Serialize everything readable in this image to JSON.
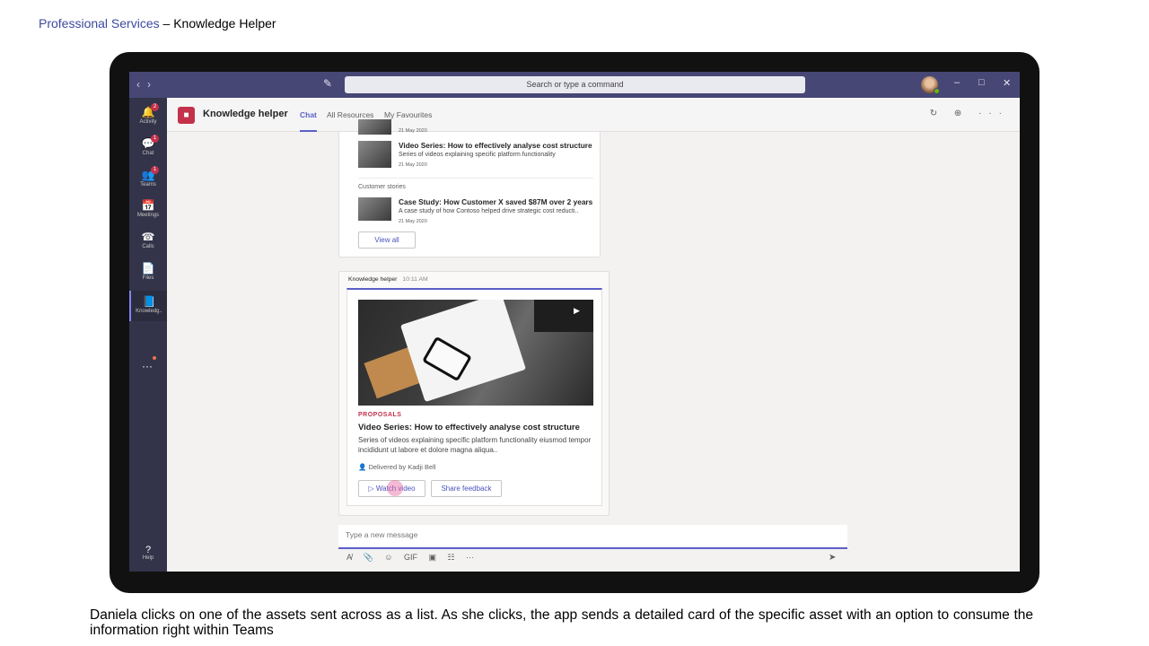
{
  "slide": {
    "title_accent": "Professional Services",
    "title_rest": " – Knowledge  Helper",
    "caption": "Daniela clicks on one of the assets sent across as a list. As she clicks, the app sends a detailed card of the specific asset with an option to consume the information right within Teams"
  },
  "titlebar": {
    "back_icon": "‹",
    "forward_icon": "›",
    "compose_icon": "✎",
    "search_placeholder": "Search or type a command",
    "minimize": "–",
    "maximize": "□",
    "close": "✕"
  },
  "rail": {
    "items": [
      {
        "label": "Activity",
        "icon": "🔔",
        "badge": "2"
      },
      {
        "label": "Chat",
        "icon": "💬",
        "badge": "1"
      },
      {
        "label": "Teams",
        "icon": "👥",
        "badge": "1"
      },
      {
        "label": "Meetings",
        "icon": "📅",
        "badge": ""
      },
      {
        "label": "Calls",
        "icon": "☎",
        "badge": ""
      },
      {
        "label": "Files",
        "icon": "📄",
        "badge": ""
      },
      {
        "label": "Knowledg..",
        "icon": "📘",
        "badge": ""
      }
    ],
    "more": "···",
    "help_icon": "?",
    "help_label": "Help"
  },
  "app": {
    "icon": "■",
    "name": "Knowledge helper",
    "tabs": [
      "Chat",
      "All Resources",
      "My Favourites"
    ],
    "header_icons": "↻ ⊕ ···"
  },
  "list_card": {
    "row0": {
      "date": "21 May 2020"
    },
    "row1": {
      "title": "Video Series: How to effectively analyse cost structure",
      "desc": "Series of videos explaining specific platform functionality",
      "date": "21 May 2020"
    },
    "section_label": "Customer stories",
    "row2": {
      "title": "Case Study: How Customer X saved $87M over 2 years",
      "desc": "A case study of how Contoso helped drive strategic cost reducti..",
      "date": "21 May 2020"
    },
    "view_all": "View all"
  },
  "detail_card": {
    "sender": "Knowledge helper",
    "time": "10:11 AM",
    "play_icon": "▶",
    "tag": "PROPOSALS",
    "title": "Video Series: How to effectively analyse cost structure",
    "desc": "Series of videos explaining specific platform functionality eiusmod tempor incididunt ut labore et dolore magna aliqua..",
    "delivered_icon": "👤",
    "delivered": "Delivered by Kadji Bell",
    "watch_label": "▷ Watch video",
    "feedback_label": "Share feedback"
  },
  "composer": {
    "placeholder": "Type a new message",
    "tools": [
      "A̸",
      "📎",
      "☺",
      "GIF",
      "▣",
      "☷",
      "···"
    ],
    "send_icon": "➤"
  }
}
